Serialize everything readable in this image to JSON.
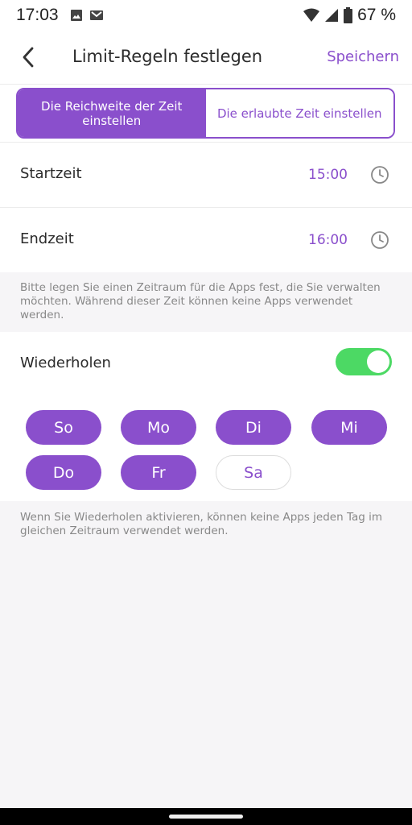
{
  "status_bar": {
    "time": "17:03",
    "battery_percent": "67 %",
    "icons": [
      "image-icon",
      "gmail-icon",
      "wifi-icon",
      "signal-icon",
      "battery-icon"
    ]
  },
  "header": {
    "title": "Limit-Regeln festlegen",
    "save_label": "Speichern"
  },
  "segmented": {
    "options": [
      "Die Reichweite der Zeit einstellen",
      "Die erlaubte Zeit einstellen"
    ],
    "selected_index": 0
  },
  "start": {
    "label": "Startzeit",
    "value": "15:00"
  },
  "end": {
    "label": "Endzeit",
    "value": "16:00"
  },
  "range_hint": "Bitte legen Sie einen Zeitraum für die Apps fest, die Sie verwalten möchten. Während dieser Zeit können keine Apps verwendet werden.",
  "repeat": {
    "label": "Wiederholen",
    "enabled": true
  },
  "days": [
    {
      "label": "So",
      "selected": true
    },
    {
      "label": "Mo",
      "selected": true
    },
    {
      "label": "Di",
      "selected": true
    },
    {
      "label": "Mi",
      "selected": true
    },
    {
      "label": "Do",
      "selected": true
    },
    {
      "label": "Fr",
      "selected": true
    },
    {
      "label": "Sa",
      "selected": false
    }
  ],
  "repeat_hint": "Wenn Sie Wiederholen aktivieren, können keine Apps jeden Tag im gleichen Zeitraum verwendet werden.",
  "colors": {
    "accent": "#8a4fcc",
    "toggle_on": "#4cd964"
  }
}
